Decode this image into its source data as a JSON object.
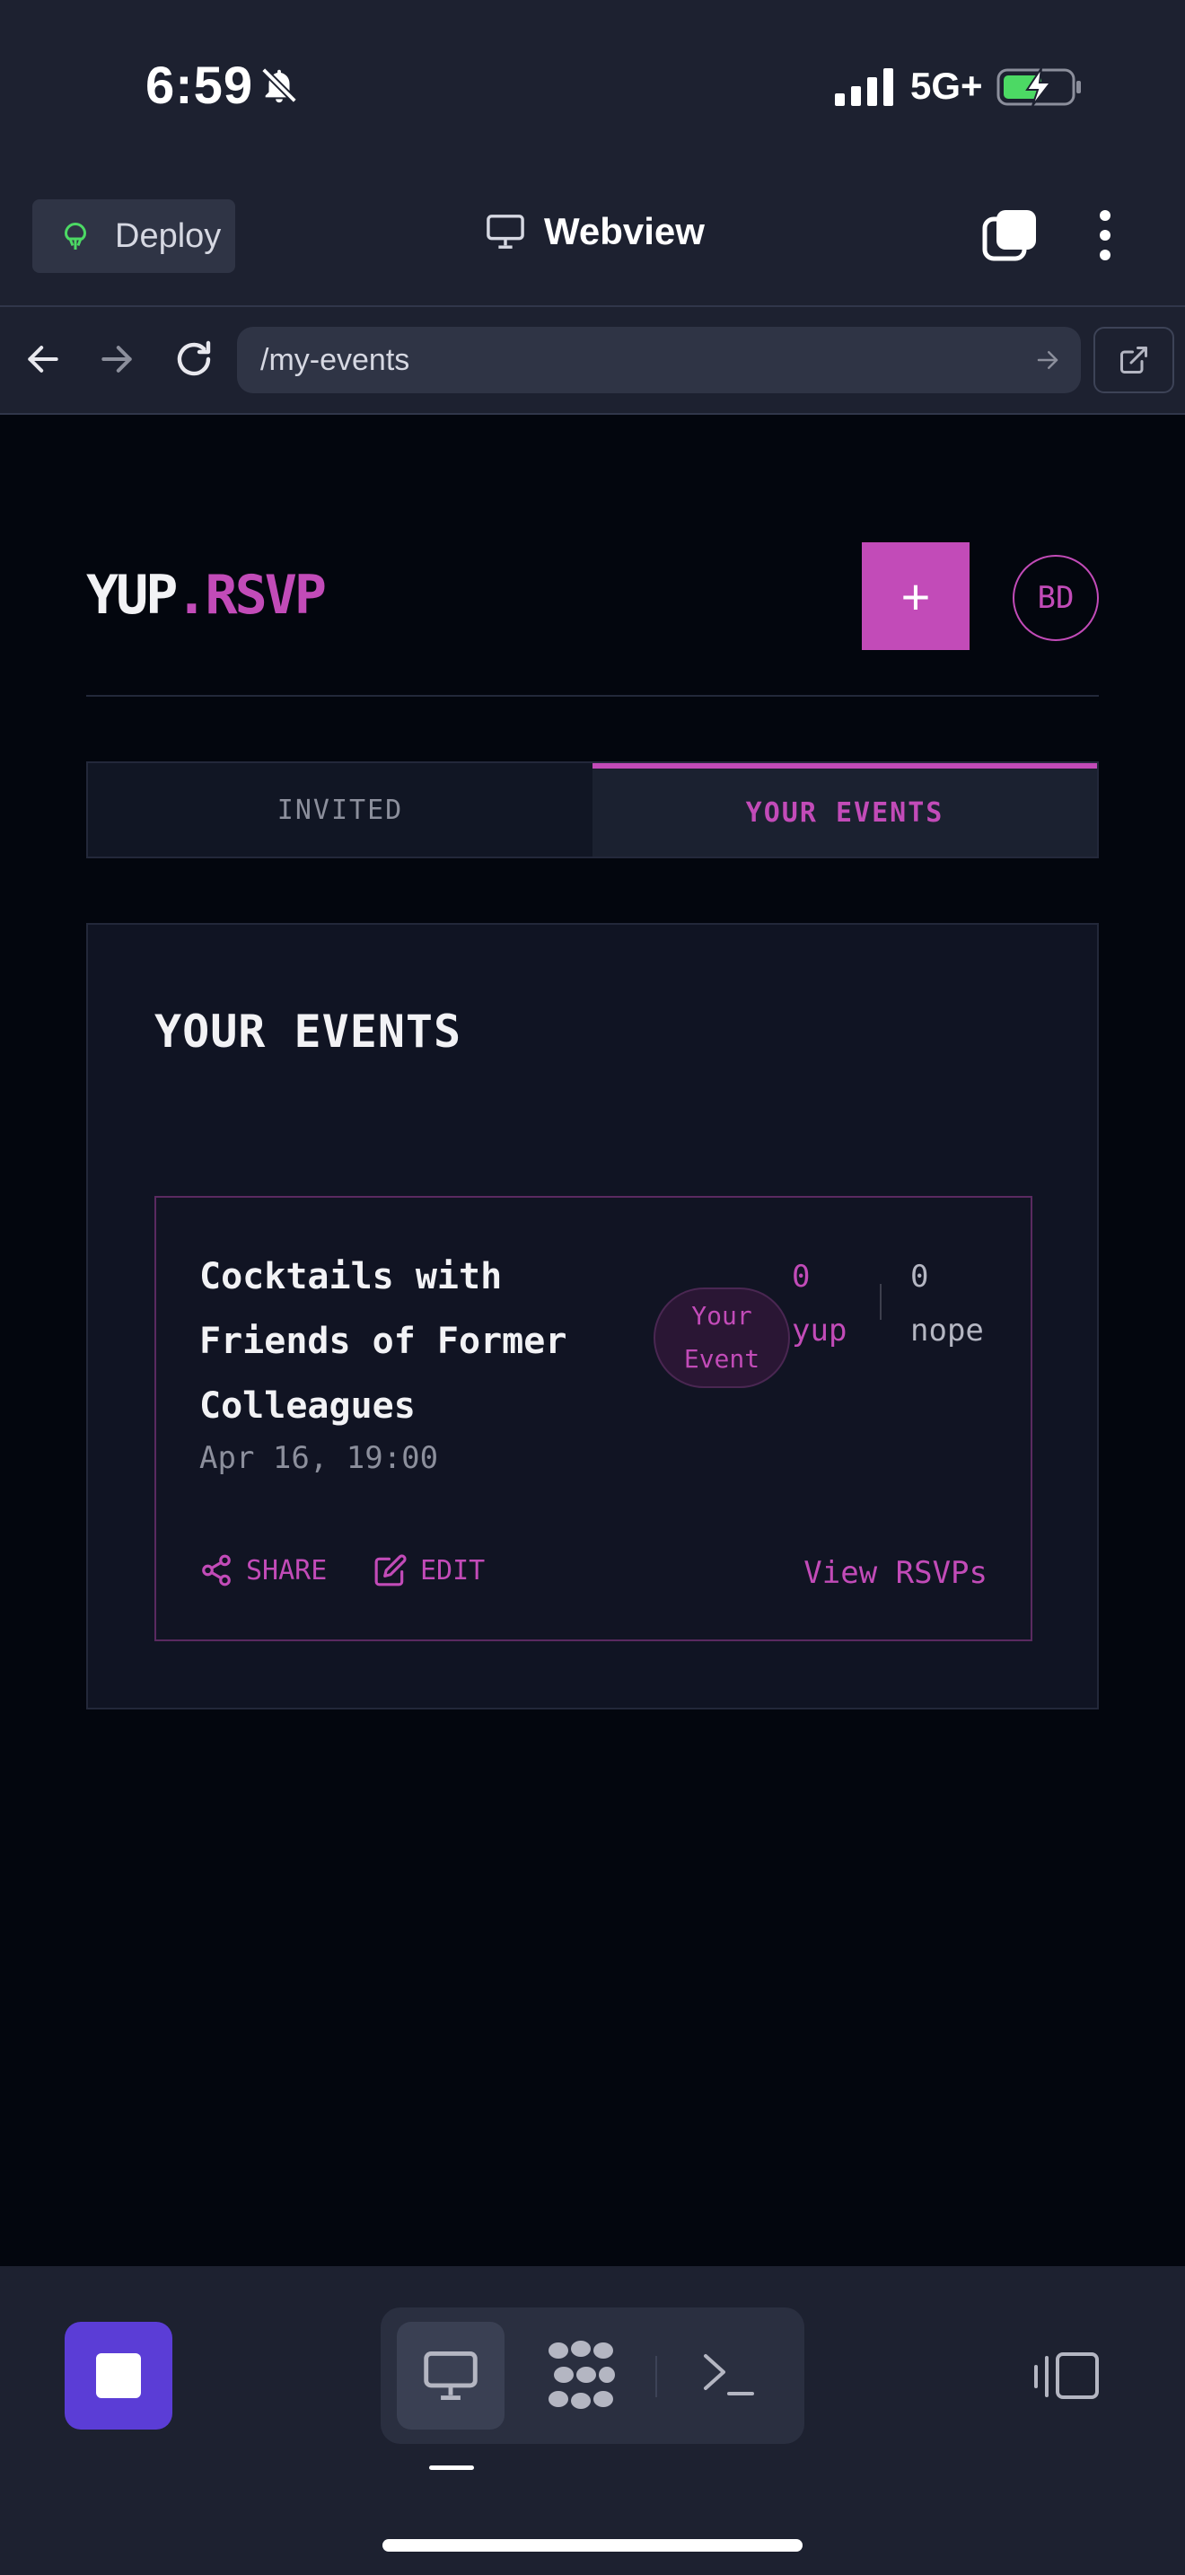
{
  "status_bar": {
    "time": "6:59",
    "network": "5G+"
  },
  "app_header": {
    "deploy_label": "Deploy",
    "webview_label": "Webview"
  },
  "address_bar": {
    "url": "/my-events"
  },
  "site": {
    "logo_part1": "YUP",
    "logo_part2": ".RSVP",
    "create_label": "+",
    "avatar_initials": "BD",
    "brand_color": "#c24bb8"
  },
  "tabs": [
    {
      "label": "INVITED",
      "active": false
    },
    {
      "label": "YOUR EVENTS",
      "active": true
    }
  ],
  "panel": {
    "title": "YOUR EVENTS"
  },
  "events": [
    {
      "title": "Cocktails with Friends of Former Colleagues",
      "date": "Apr 16, 19:00",
      "badge_line1": "Your",
      "badge_line2": "Event",
      "yup_count": "0",
      "yup_label": "yup",
      "nope_count": "0",
      "nope_label": "nope",
      "share_label": "SHARE",
      "edit_label": "EDIT",
      "view_rsvps_label": "View RSVPs"
    }
  ],
  "toolbar": {
    "icons": [
      "stop-icon",
      "desktop-icon",
      "agent-dots-icon",
      "terminal-icon",
      "panel-toggle-icon"
    ]
  }
}
